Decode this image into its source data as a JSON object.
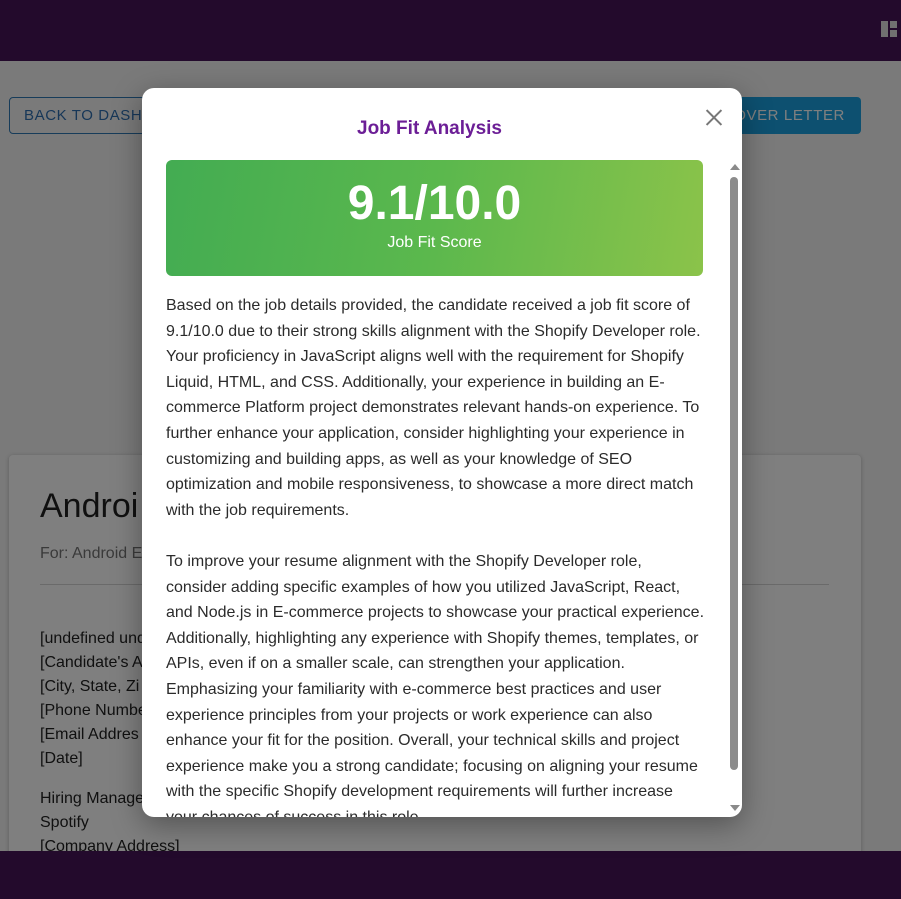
{
  "app": {
    "top_icon": "dashboard-grid-icon",
    "bar_color": "#461558"
  },
  "page": {
    "back_button_label": "BACK TO DASHB",
    "cover_letter_button_label": "OVER LETTER",
    "card": {
      "title": "Androi",
      "subtitle": "For: Android E",
      "letter_lines": [
        "[undefined und",
        "[Candidate's A",
        "[City, State, Zi",
        "[Phone Numbe",
        "[Email Addres",
        "[Date]"
      ],
      "recipient_lines": [
        "Hiring Manage",
        "Spotify",
        "[Company Address]"
      ]
    }
  },
  "modal": {
    "title": "Job Fit Analysis",
    "close_icon": "close-icon",
    "score": {
      "value": "9.1/10.0",
      "label": "Job Fit Score",
      "gradient_start": "#43ac52",
      "gradient_end": "#8bc34a"
    },
    "analysis_paragraphs": [
      "Based on the job details provided, the candidate received a job fit score of 9.1/10.0 due to their strong skills alignment with the Shopify Developer role. Your proficiency in JavaScript aligns well with the requirement for Shopify Liquid, HTML, and CSS. Additionally, your experience in building an E-commerce Platform project demonstrates relevant hands-on experience. To further enhance your application, consider highlighting your experience in customizing and building apps, as well as your knowledge of SEO optimization and mobile responsiveness, to showcase a more direct match with the job requirements.",
      "To improve your resume alignment with the Shopify Developer role, consider adding specific examples of how you utilized JavaScript, React, and Node.js in E-commerce projects to showcase your practical experience. Additionally, highlighting any experience with Shopify themes, templates, or APIs, even if on a smaller scale, can strengthen your application. Emphasizing your familiarity with e-commerce best practices and user experience principles from your projects or work experience can also enhance your fit for the position. Overall, your technical skills and project experience make you a strong candidate; focusing on aligning your resume with the specific Shopify development requirements will further increase your chances of success in this role."
    ]
  }
}
